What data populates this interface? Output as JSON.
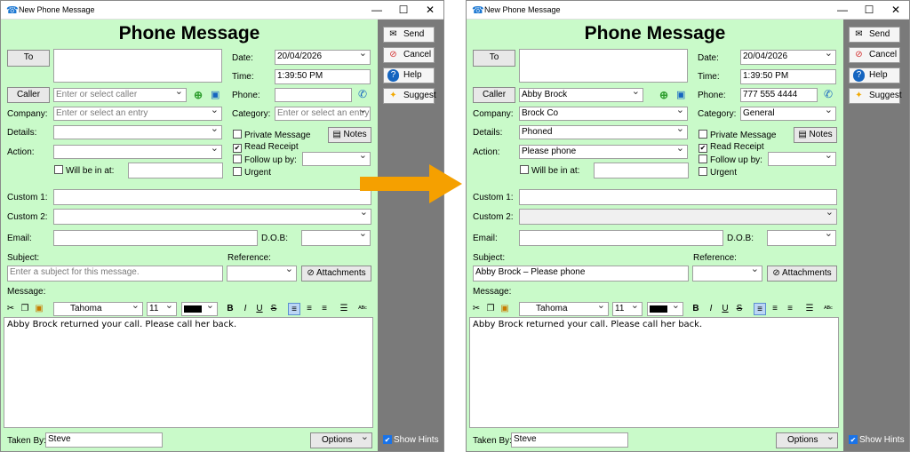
{
  "title_bar": "New Phone Message",
  "heading": "Phone Message",
  "window_controls": {
    "minimize": "—",
    "maximize": "☐",
    "close": "✕"
  },
  "sidebar": {
    "send": "Send",
    "cancel": "Cancel",
    "help": "Help",
    "suggest": "Suggest",
    "show_hints": "Show Hints"
  },
  "labels": {
    "to": "To",
    "caller": "Caller",
    "company": "Company:",
    "details": "Details:",
    "action": "Action:",
    "will_be_in_at": "Will be in at:",
    "date": "Date:",
    "time": "Time:",
    "phone": "Phone:",
    "category": "Category:",
    "private_message": "Private Message",
    "read_receipt": "Read Receipt",
    "follow_up_by": "Follow up by:",
    "urgent": "Urgent",
    "notes": "Notes",
    "custom1": "Custom 1:",
    "custom2": "Custom 2:",
    "email": "Email:",
    "dob": "D.O.B:",
    "subject": "Subject:",
    "reference": "Reference:",
    "attachments": "Attachments",
    "message": "Message:",
    "taken_by": "Taken By:",
    "options": "Options"
  },
  "toolbar": {
    "font": "Tahoma",
    "size": "11",
    "bold": "B",
    "italic": "I",
    "underline": "U",
    "strike": "S"
  },
  "before": {
    "caller": "Enter or select caller",
    "company": "Enter or select an entry",
    "details": "",
    "action": "",
    "date": "20/04/2026",
    "time": "1:39:50 PM",
    "phone": "",
    "category": "Enter or select an entry",
    "subject": "Enter a subject for this message.",
    "message": "Abby Brock returned your call. Please call her back.",
    "taken_by": "Steve"
  },
  "after": {
    "caller": "Abby Brock",
    "company": "Brock Co",
    "details": "Phoned",
    "action": "Please phone",
    "date": "20/04/2026",
    "time": "1:39:50 PM",
    "phone": "777 555 4444",
    "category": "General",
    "subject": "Abby Brock – Please phone",
    "message": "Abby Brock returned your call. Please call her back.",
    "taken_by": "Steve"
  },
  "colors": {
    "form_bg": "#c9fac9",
    "sidebar_bg": "#7a7a7a",
    "arrow": "#f5a000"
  },
  "icons": {
    "app": "phone-icon",
    "send": "envelope-icon",
    "cancel": "cancel-icon",
    "help": "help-icon",
    "suggest": "sparkle-icon",
    "arrow": "right-arrow-icon"
  }
}
